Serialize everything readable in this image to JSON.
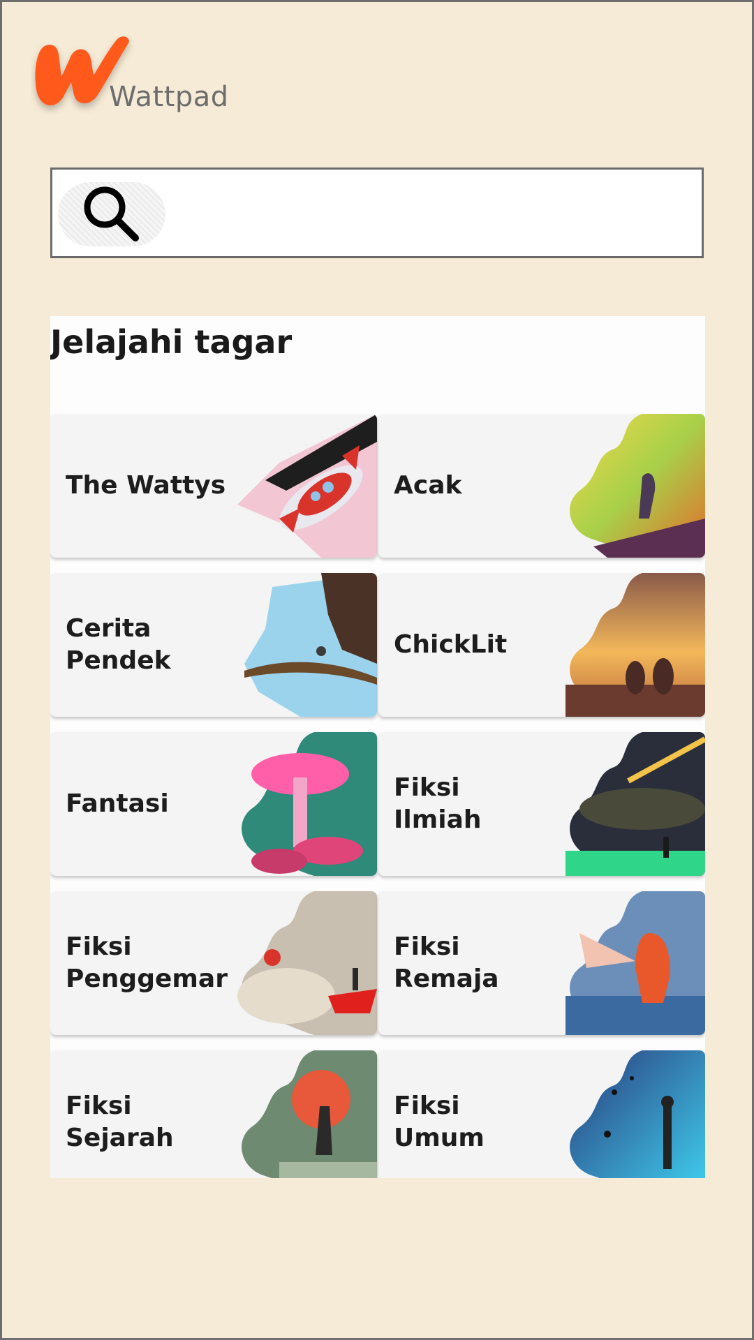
{
  "app": {
    "logo_text": "Wattpad",
    "brand_color": "#ff5a1f"
  },
  "search": {
    "value": "",
    "placeholder": "",
    "icon": "search-icon"
  },
  "explore": {
    "title": "Jelajahi tagar",
    "tags": [
      {
        "label": "The Wattys",
        "art": "rocket"
      },
      {
        "label": "Acak",
        "art": "fire-cliff"
      },
      {
        "label": "Cerita\nPendek",
        "art": "ice-cliff"
      },
      {
        "label": "ChickLit",
        "art": "sunset-couple"
      },
      {
        "label": "Fantasi",
        "art": "mushroom"
      },
      {
        "label": "Fiksi Ilmiah",
        "art": "meteor"
      },
      {
        "label": "Fiksi\nPenggemar",
        "art": "paper-boat"
      },
      {
        "label": "Fiksi\nRemaja",
        "art": "hooded-figure"
      },
      {
        "label": "Fiksi\nSejarah",
        "art": "samurai-moon"
      },
      {
        "label": "Fiksi\nUmum",
        "art": "space-figure"
      }
    ]
  }
}
